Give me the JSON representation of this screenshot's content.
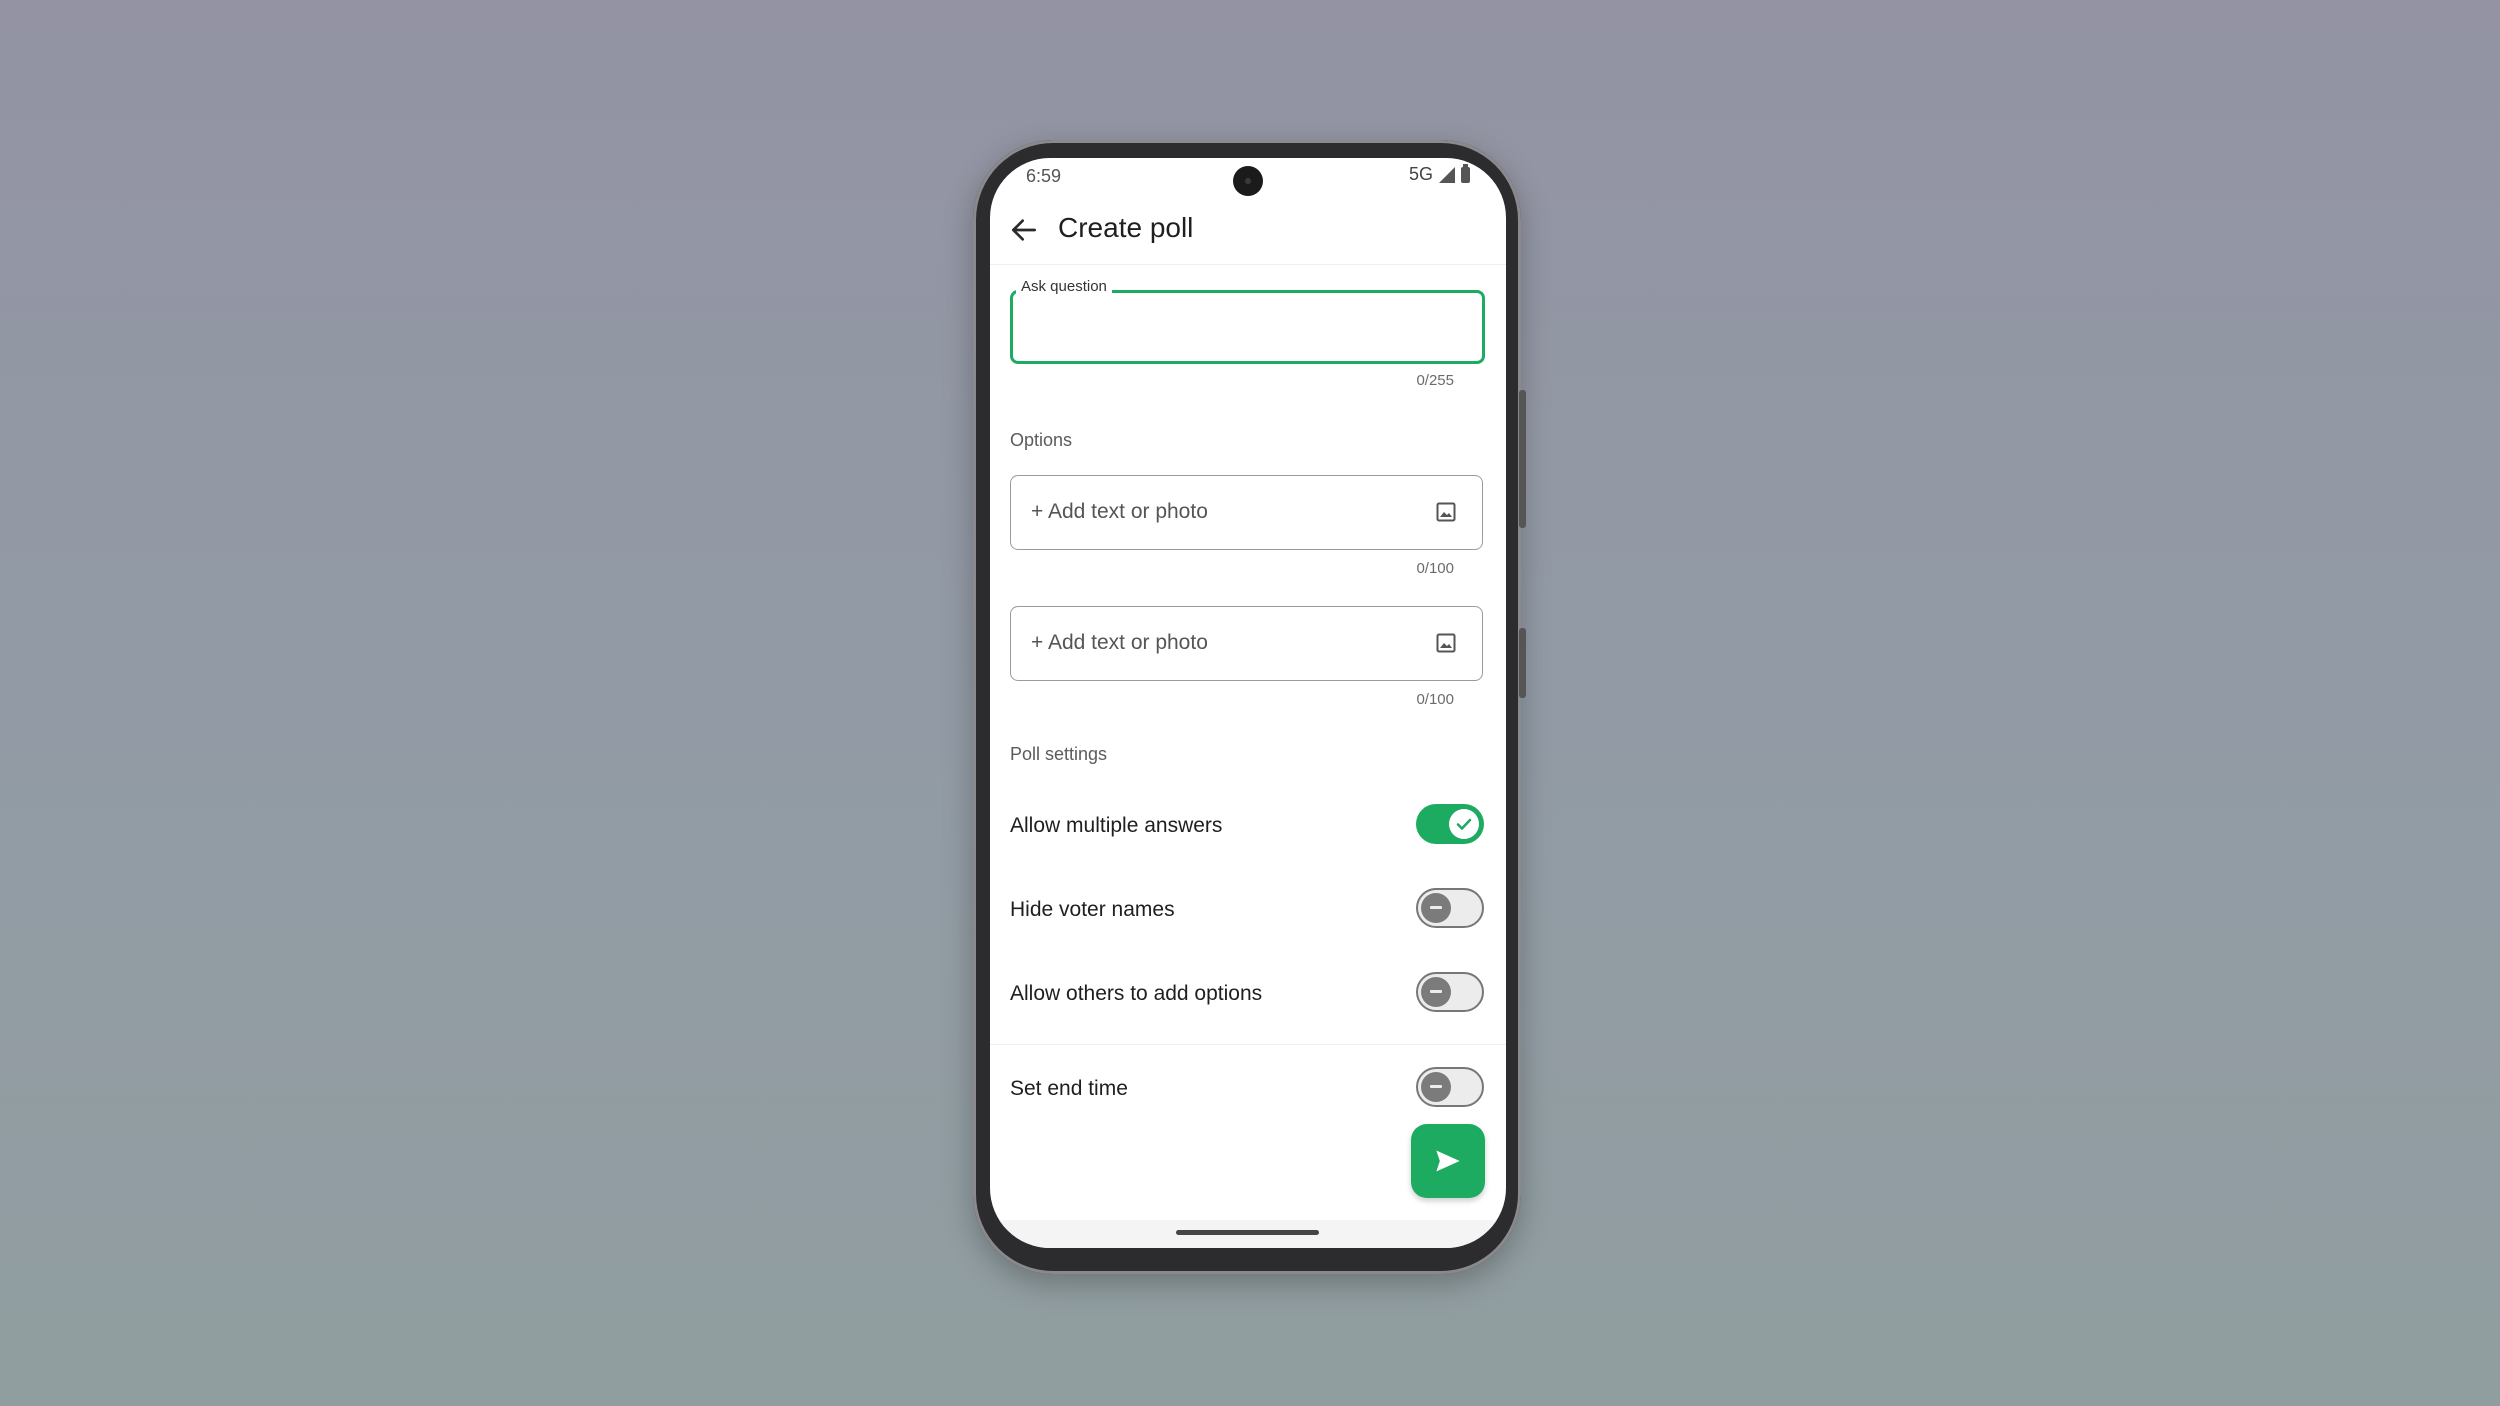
{
  "status_bar": {
    "time": "6:59",
    "network": "5G",
    "icons": [
      "signal-icon",
      "battery-icon"
    ]
  },
  "app_bar": {
    "back_icon": "arrow-left-icon",
    "title": "Create poll"
  },
  "question": {
    "label": "Ask question",
    "value": "",
    "counter": "0/255"
  },
  "options": {
    "section_label": "Options",
    "items": [
      {
        "placeholder": "+ Add text or photo",
        "icon": "image-icon",
        "counter": "0/100"
      },
      {
        "placeholder": "+ Add text or photo",
        "icon": "image-icon",
        "counter": "0/100"
      }
    ]
  },
  "poll_settings": {
    "section_label": "Poll settings",
    "items": [
      {
        "label": "Allow multiple answers",
        "enabled": true
      },
      {
        "label": "Hide voter names",
        "enabled": false
      },
      {
        "label": "Allow others to add options",
        "enabled": false
      },
      {
        "label": "Set end time",
        "enabled": false
      }
    ]
  },
  "fab": {
    "icon": "send-icon"
  },
  "colors": {
    "accent": "#1daa61",
    "background_top": "#9393a3",
    "background_bottom": "#919ea0"
  }
}
